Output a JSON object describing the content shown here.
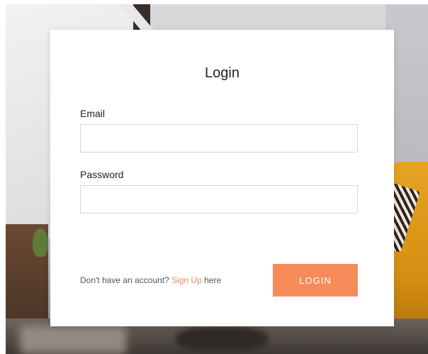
{
  "form": {
    "title": "Login",
    "email_label": "Email",
    "email_value": "",
    "password_label": "Password",
    "password_value": "",
    "signup_prefix": "Don't have an account?",
    "signup_link": "Sign Up",
    "signup_suffix": "here",
    "login_button": "LOGIN"
  },
  "colors": {
    "accent": "#f58c5a",
    "link": "#f08a5d"
  }
}
